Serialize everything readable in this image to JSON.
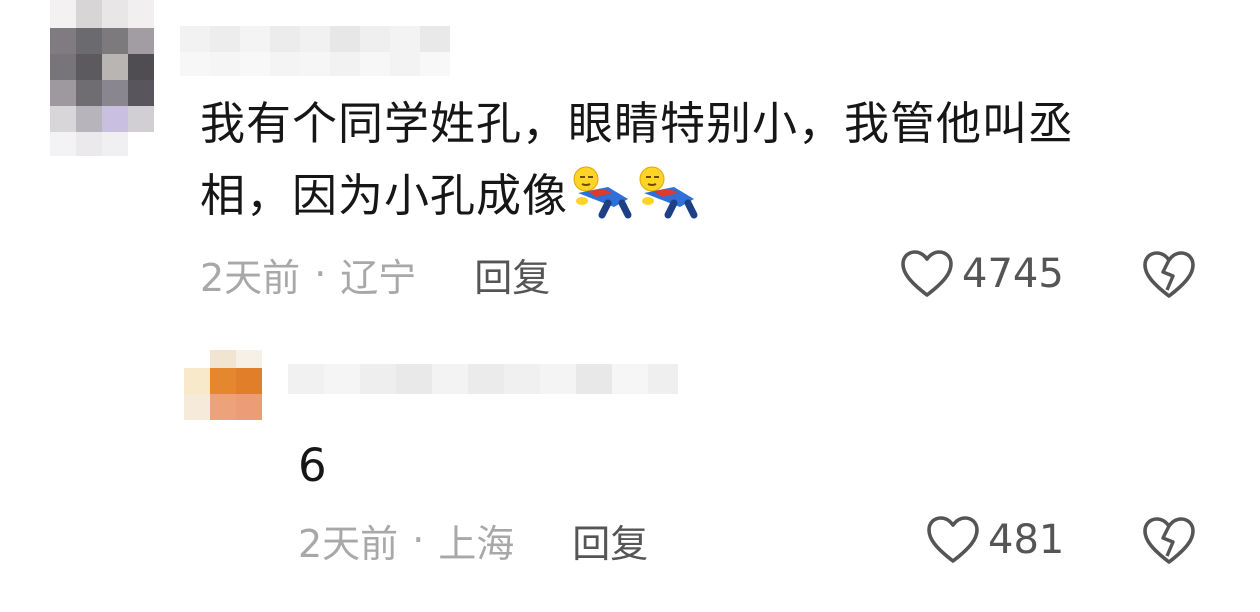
{
  "comments": [
    {
      "text_line1": "我有个同学姓孔，眼睛特别小，我管他叫丞",
      "text_line2": "相，因为小孔成像",
      "emoji": "lying-down-emoji",
      "time": "2天前",
      "separator": "·",
      "location": "辽宁",
      "reply_label": "回复",
      "likes": "4745"
    },
    {
      "text": "6",
      "time": "2天前",
      "separator": "·",
      "location": "上海",
      "reply_label": "回复",
      "likes": "481"
    }
  ],
  "icons": {
    "like": "heart-outline-icon",
    "dislike": "broken-heart-icon"
  },
  "colors": {
    "text": "#161616",
    "meta": "#a8a8a8",
    "reply": "#555555"
  }
}
